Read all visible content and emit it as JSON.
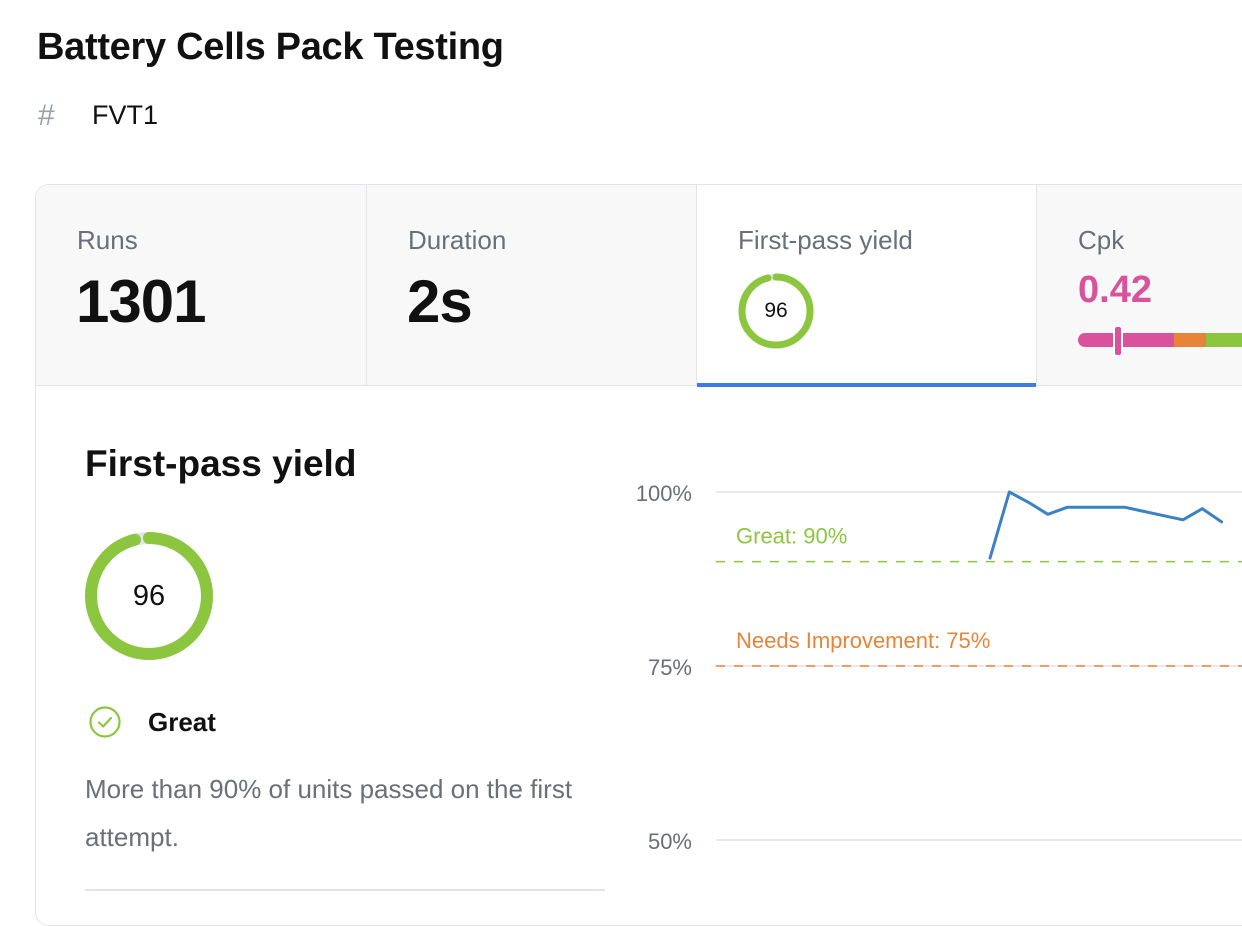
{
  "page": {
    "title": "Battery Cells Pack Testing"
  },
  "subline": {
    "icon": "hash-icon",
    "label": "FVT1"
  },
  "tabs": {
    "runs": {
      "label": "Runs",
      "value": "1301"
    },
    "duration": {
      "label": "Duration",
      "value": "2s"
    },
    "first_pass_yield": {
      "label": "First-pass yield",
      "value": "96",
      "percent": 96
    },
    "cpk": {
      "label": "Cpk",
      "value": "0.42"
    }
  },
  "detail": {
    "title": "First-pass yield",
    "score": "96",
    "score_percent": 96,
    "status": "Great",
    "status_icon": "check-circle-icon",
    "description": "More than 90% of units passed on the first attempt."
  },
  "colors": {
    "great": "#8cc63f",
    "needs_improvement": "#e8843a",
    "poor": "#d9529b",
    "series": "#3a82c4",
    "accent": "#3b7be8"
  },
  "chart_data": {
    "type": "line",
    "y_tick_labels": [
      "100%",
      "75%",
      "50%"
    ],
    "ylim": [
      50,
      100
    ],
    "grid": true,
    "thresholds": [
      {
        "label": "Great: 90%",
        "value": 90,
        "color": "#8cc63f"
      },
      {
        "label": "Needs Improvement: 75%",
        "value": 75,
        "color": "#e8843a"
      }
    ],
    "series": [
      {
        "values": [
          90.5,
          100,
          98.5,
          96.8,
          97.8,
          97.8,
          97.8,
          97.8,
          97.2,
          96.6,
          96,
          97.6,
          95.7
        ]
      }
    ]
  }
}
